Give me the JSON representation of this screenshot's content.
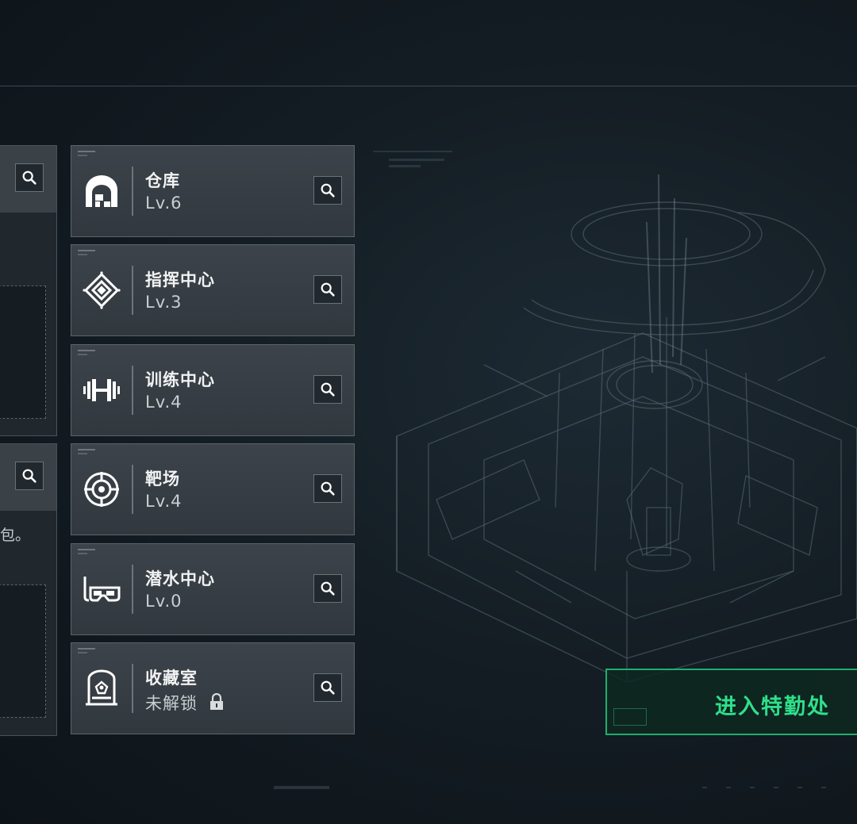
{
  "left_panel": {
    "fragment_text": "包。"
  },
  "buildings": [
    {
      "name": "仓库",
      "level": "Lv.6",
      "icon": "warehouse-icon"
    },
    {
      "name": "指挥中心",
      "level": "Lv.3",
      "icon": "command-center-icon"
    },
    {
      "name": "训练中心",
      "level": "Lv.4",
      "icon": "dumbbell-icon"
    },
    {
      "name": "靶场",
      "level": "Lv.4",
      "icon": "target-icon"
    },
    {
      "name": "潜水中心",
      "level": "Lv.0",
      "icon": "diving-mask-icon"
    },
    {
      "name": "收藏室",
      "level": "未解锁",
      "icon": "trophy-case-icon",
      "locked": true
    }
  ],
  "enter_button": {
    "label": "进入特勤处"
  },
  "colors": {
    "accent_green": "#2ee08a",
    "card_bg": "#3c434a",
    "page_bg": "#141d24"
  }
}
